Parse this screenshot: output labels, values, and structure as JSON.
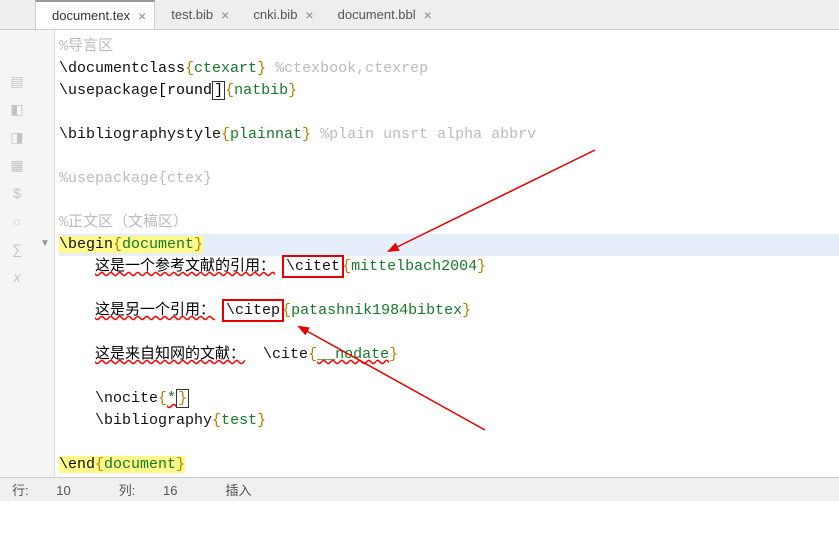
{
  "tabs": [
    {
      "label": "document.tex"
    },
    {
      "label": "test.bib"
    },
    {
      "label": "cnki.bib"
    },
    {
      "label": "document.bbl"
    }
  ],
  "code": {
    "l1": "%导言区",
    "l2c": "\\documentclass",
    "l2a": "ctexart",
    "l2cm": " %ctexbook,ctexrep",
    "l3c": "\\usepackage",
    "l3o": "round",
    "l3a": "natbib",
    "l5c": "\\bibliographystyle",
    "l5a": "plainnat",
    "l5cm": " %plain unsrt alpha abbrv",
    "l7": "%usepackage{ctex}",
    "l9": "%正文区（文稿区）",
    "l10c": "\\begin",
    "l10a": "document",
    "l11t": "这是一个参考文献的引用：",
    "l11c": "\\citet",
    "l11a": "mittelbach2004",
    "l13t": "这是另一个引用：",
    "l13c": "\\citep",
    "l13a": "patashnik1984bibtex",
    "l15t": "这是来自知网的文献：",
    "l15c": "\\cite",
    "l15a": "__nodate",
    "l17c": "\\nocite",
    "l17a": "*",
    "l18c": "\\bibliography",
    "l18a": "test",
    "l20c": "\\end",
    "l20a": "document"
  },
  "status": {
    "row_label": "行:",
    "row": "10",
    "col_label": "列:",
    "col": "16",
    "mode": "插入"
  }
}
